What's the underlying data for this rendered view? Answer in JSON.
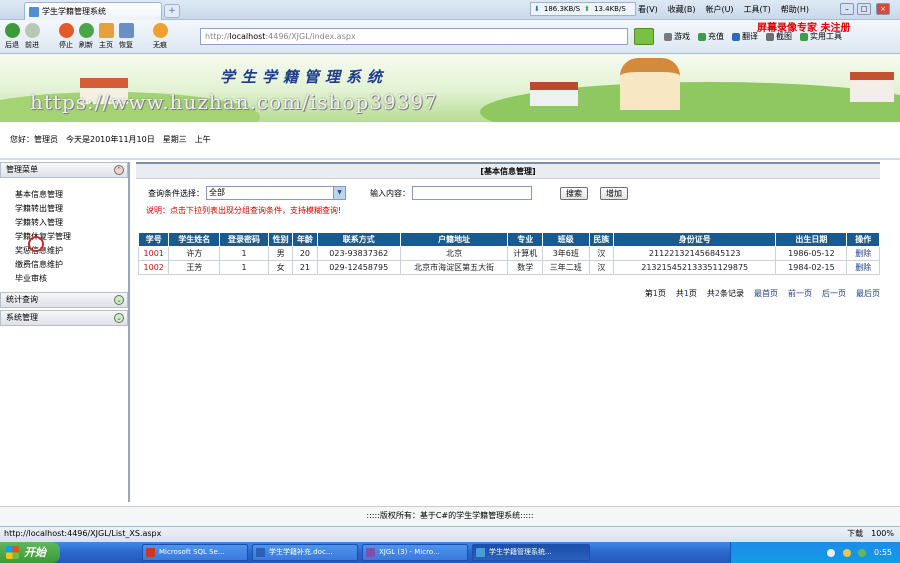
{
  "browser": {
    "tab_title": "学生学籍管理系统",
    "new_tab": "+",
    "download_speed": "186.3KB/S",
    "upload_speed": "13.4KB/S",
    "menu": [
      "看(V)",
      "收藏(B)",
      "帐户(U)",
      "工具(T)",
      "帮助(H)"
    ],
    "recorder_banner": "屏幕录像专家 未注册",
    "toolbar": [
      "后退",
      "前进",
      "停止",
      "刷新",
      "主页",
      "恢复",
      "无痕"
    ],
    "address_prefix": "http://",
    "address_host": "localhost",
    "address_path": ":4496/XJGL/index.aspx",
    "right_tools": [
      "游戏",
      "充值",
      "翻译",
      "截图",
      "实用工具"
    ],
    "status_url": "http://localhost:4496/XJGL/List_XS.aspx",
    "status_right": [
      "下载",
      "100%"
    ],
    "colors": {
      "accent": "#1a5b8f",
      "hint": "#d80000"
    }
  },
  "page": {
    "system_title": "学生学籍管理系统",
    "watermark": "https://www.huzhan.com/ishop39397",
    "welcome": [
      "您好：管理员",
      "今天是2010年11月10日",
      "星期三",
      "上午"
    ],
    "footer": ":::::版权所有：基于C#的学生学籍管理系统:::::"
  },
  "sidebar": {
    "sections": [
      {
        "label": "管理菜单",
        "state": "expanded"
      },
      {
        "label": "统计查询",
        "state": "collapsed"
      },
      {
        "label": "系统管理",
        "state": "collapsed"
      }
    ],
    "items": [
      "基本信息管理",
      "学籍转出管理",
      "学籍转入管理",
      "学籍休复学管理",
      "奖惩信息维护",
      "缴费信息维护",
      "毕业审核"
    ]
  },
  "main": {
    "panel_title": "[基本信息管理]",
    "query_label": "查询条件选择：",
    "query_value": "全部",
    "input_label": "输入内容：",
    "search_button": "搜索",
    "add_button": "增加",
    "hint": "说明：点击下拉列表出现分组查询条件，支持模糊查询!",
    "columns": [
      "学号",
      "学生姓名",
      "登录密码",
      "性别",
      "年龄",
      "联系方式",
      "户籍地址",
      "专业",
      "班级",
      "民族",
      "身份证号",
      "出生日期",
      "操作"
    ],
    "rows": [
      [
        "1001",
        "许方",
        "1",
        "男",
        "20",
        "023-93837362",
        "北京",
        "计算机",
        "3年6班",
        "汉",
        "211221321456845123",
        "1986-05-12",
        "删除"
      ],
      [
        "1002",
        "王芳",
        "1",
        "女",
        "21",
        "029-12458795",
        "北京市海淀区第五大街",
        "数学",
        "三年二班",
        "汉",
        "213215452133351129875",
        "1984-02-15",
        "删除"
      ]
    ],
    "pager": {
      "page_pre": "第",
      "page_num": "1",
      "page_suf": "页",
      "total_pre": "共",
      "total_num": "1",
      "total_suf": "页",
      "count_pre": "共",
      "count_num": "2",
      "count_suf": "条记录",
      "first": "最首页",
      "prev": "前一页",
      "next": "后一页",
      "last": "最后页"
    }
  },
  "taskbar": {
    "start": "开始",
    "tasks": [
      "Microsoft SQL Se...",
      "学生学籍补充.doc...",
      "XJGL (3) - Micro...",
      "学生学籍管理系统..."
    ],
    "clock": "0:55"
  }
}
